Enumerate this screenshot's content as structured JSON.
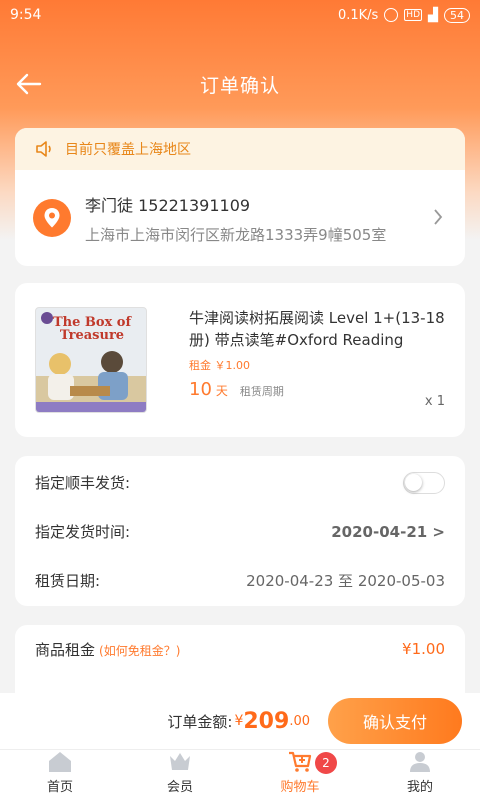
{
  "status_bar": {
    "time": "9:54",
    "network_speed": "0.1K/s",
    "battery": "54",
    "hd": "HD"
  },
  "nav": {
    "title": "订单确认"
  },
  "notice": {
    "text": "目前只覆盖上海地区"
  },
  "address": {
    "name_phone": "李门徒 15221391109",
    "line": "上海市上海市闵行区新龙路1333弄9幢505室"
  },
  "product": {
    "cover_title_1": "The Box of",
    "cover_title_2": "Treasure",
    "name": "牛津阅读树拓展阅读 Level 1+(13-18册) 带点读笔#Oxford Reading",
    "rent": "租金 ￥1.00",
    "days": "10",
    "days_unit": "天",
    "period_label": "租赁周期",
    "qty": "x 1"
  },
  "options": {
    "sf_label": "指定顺丰发货:",
    "ship_time_label": "指定发货时间:",
    "ship_time_value": "2020-04-21 >",
    "rent_date_label": "租赁日期:",
    "rent_date_value": "2020-04-23 至 2020-05-03"
  },
  "fees": {
    "rent_label": "商品租金",
    "rent_hint": "(如何免租金？)",
    "rent_value": "¥1.00"
  },
  "checkout": {
    "total_label": "订单金额:",
    "currency": "¥",
    "amount": "209",
    "decimal": ".00",
    "pay_label": "确认支付"
  },
  "tabs": [
    {
      "label": "首页",
      "icon": "home-icon"
    },
    {
      "label": "会员",
      "icon": "crown-icon"
    },
    {
      "label": "购物车",
      "icon": "cart-icon",
      "badge": "2"
    },
    {
      "label": "我的",
      "icon": "profile-icon"
    }
  ],
  "colors": {
    "accent": "#ff7a2e",
    "price": "#ff6a1a",
    "notice_text": "#e8871a",
    "badge": "#f04848"
  }
}
